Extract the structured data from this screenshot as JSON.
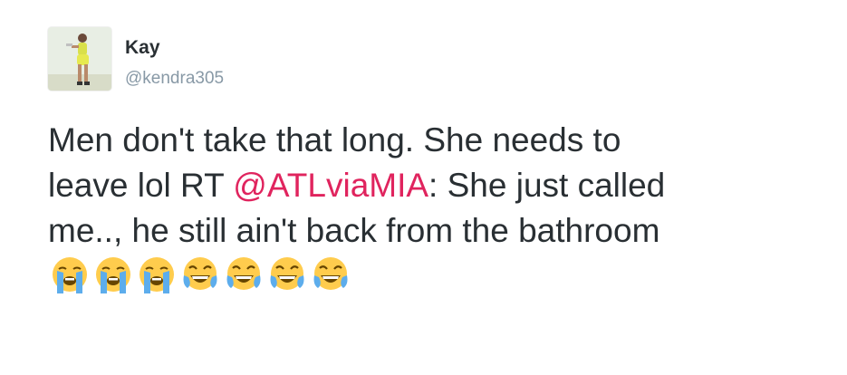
{
  "tweet": {
    "name": "Kay",
    "handle": "@kendra305",
    "text_line1": "Men don't take that long. She needs to",
    "text_line2_before": "leave lol RT ",
    "mention": "@ATLviaMIA",
    "text_line2_after": ": She just called",
    "text_line3": "me.., he still ain't back from the bathroom",
    "emojis": [
      "loudly-crying-face-icon",
      "loudly-crying-face-icon",
      "loudly-crying-face-icon",
      "face-with-tears-of-joy-icon",
      "face-with-tears-of-joy-icon",
      "face-with-tears-of-joy-icon",
      "face-with-tears-of-joy-icon"
    ],
    "colors": {
      "text": "#292f33",
      "handle": "#8899a6",
      "mention": "#e0245e",
      "emoji_face": "#ffcc4d",
      "emoji_tears": "#5dadec"
    }
  }
}
